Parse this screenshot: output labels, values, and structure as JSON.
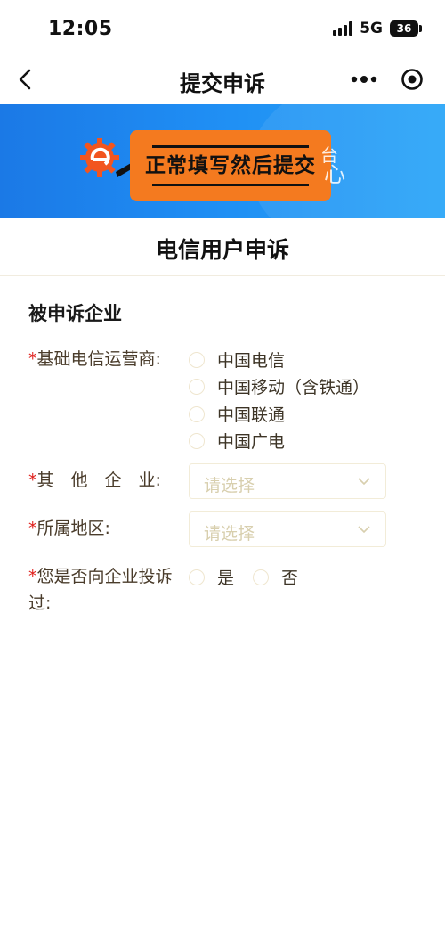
{
  "status_bar": {
    "time": "12:05",
    "network": "5G",
    "battery": "36"
  },
  "nav": {
    "title": "提交申诉"
  },
  "banner": {
    "label": "正常填写然后提交",
    "ghost_top": "台",
    "ghost_bottom": "心"
  },
  "page": {
    "title": "电信用户申诉"
  },
  "section": {
    "title": "被申诉企业"
  },
  "form": {
    "required_mark": "*",
    "carrier": {
      "label": "基础电信运营商:",
      "options": [
        "中国电信",
        "中国移动（含铁通）",
        "中国联通",
        "中国广电"
      ]
    },
    "other": {
      "label": "其　他　企　业:",
      "placeholder": "请选择"
    },
    "region": {
      "label": "所属地区:",
      "placeholder": "请选择"
    },
    "complained": {
      "label_line1": "您是否向企业投诉",
      "label_line2": "过:",
      "yes": "是",
      "no": "否"
    }
  },
  "colors": {
    "banner_blue": "#1f8df3",
    "banner_orange": "#f47a1f",
    "required_red": "#e0201c"
  }
}
